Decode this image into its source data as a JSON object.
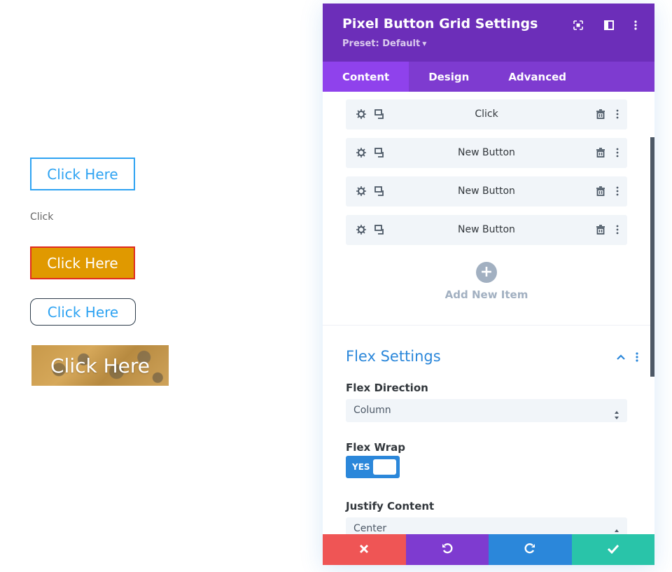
{
  "preview": {
    "button1_label": "Click Here",
    "plain_text": "Click",
    "button2_label": "Click Here",
    "button3_label": "Click Here",
    "button4_label": "Click Here"
  },
  "panel": {
    "title": "Pixel Button Grid Settings",
    "preset": "Preset: Default",
    "header_icons": [
      "fullscreen-icon",
      "split-view-icon",
      "more-vertical-icon"
    ],
    "tabs": [
      {
        "label": "Content",
        "active": true
      },
      {
        "label": "Design",
        "active": false
      },
      {
        "label": "Advanced",
        "active": false
      }
    ],
    "items": [
      {
        "label": "Click"
      },
      {
        "label": "New Button"
      },
      {
        "label": "New Button"
      },
      {
        "label": "New Button"
      }
    ],
    "add_new_label": "Add New Item",
    "section": {
      "title": "Flex Settings",
      "flex_direction_label": "Flex Direction",
      "flex_direction_value": "Column",
      "flex_wrap_label": "Flex Wrap",
      "flex_wrap_toggle": "YES",
      "justify_content_label": "Justify Content",
      "justify_content_value": "Center"
    },
    "footer": [
      "close-icon",
      "undo-icon",
      "redo-icon",
      "check-icon"
    ]
  },
  "colors": {
    "header": "#6c2eb9",
    "tabs": "#7e3bd0",
    "active_tab": "#8f42ec",
    "accent_blue": "#2b87da",
    "discard": "#ef5555",
    "save": "#29c4a9",
    "orange_button": "#e09900"
  }
}
